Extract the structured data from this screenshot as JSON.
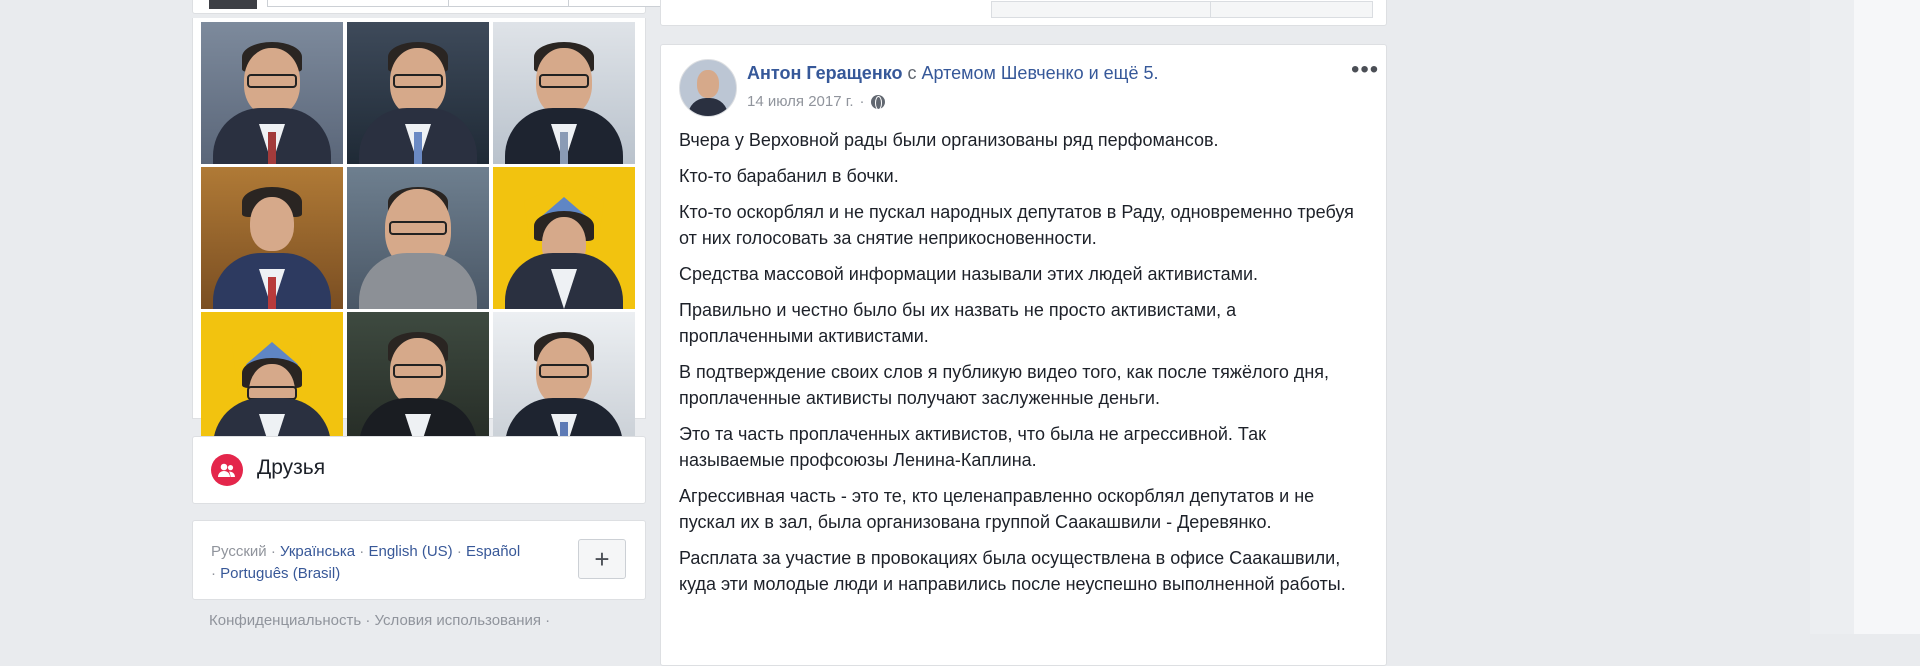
{
  "post": {
    "author": "Антон Геращенко",
    "with_word": "с",
    "tagged": "Артемом Шевченко и ещё 5.",
    "date": "14 июля 2017 г.",
    "more_icon": "more-icon",
    "paragraphs": [
      "Вчера у Верховной рады были организованы ряд перфомансов.",
      "Кто-то барабанил в бочки.",
      "Кто-то оскорблял и не пускал народных депутатов в Раду, одновременно требуя от них голосовать за снятие неприкосновенности.",
      "Средства массовой информации называли этих людей активистами.",
      "Правильно и честно было бы их назвать не просто активистами, а проплаченными активистами.",
      "В подтверждение своих слов я публикую видео того, как после тяжёлого дня, проплаченные активисты получают заслуженные деньги.",
      "Это та часть проплаченных активистов, что была не агрессивной. Так называемые профсоюзы Ленина-Каплина.",
      "Агрессивная часть - это те, кто целенаправленно оскорблял депутатов и не пускал их в зал, была организована группой Саакашвили - Деревянко.",
      "Расплата за участие в провокациях была осуществлена в офисе Саакашвили, куда эти молодые люди и направились после неуспешно выполненной работы."
    ]
  },
  "friends": {
    "title": "Друзья",
    "icon": "friends-icon",
    "color": "#e4264b"
  },
  "languages": {
    "current": "Русский",
    "sep": " · ",
    "lang1": "Українська",
    "lang2": "English (US)",
    "lang3": "Español",
    "lang4": "Português (Brasil)",
    "add": "+"
  },
  "footer": {
    "privacy": "Конфиденциальность",
    "terms": "Условия использования",
    "sep": " · "
  },
  "colors": {
    "link": "#365899",
    "background": "#e9ebee"
  }
}
